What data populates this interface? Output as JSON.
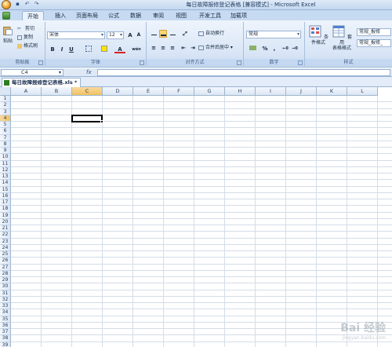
{
  "window": {
    "title": "每日故障报修登记表格 [兼容模式] - Microsoft Excel"
  },
  "quick_access": [
    "save-icon",
    "undo-icon",
    "redo-icon"
  ],
  "tabs": [
    "开始",
    "插入",
    "页面布局",
    "公式",
    "数据",
    "审阅",
    "视图",
    "开发工具",
    "加载项"
  ],
  "active_tab": "开始",
  "ribbon": {
    "clipboard": {
      "label": "剪贴板",
      "paste": "粘贴",
      "cut": "剪切",
      "copy": "复制",
      "format_painter": "格式刷"
    },
    "font": {
      "label": "字体",
      "name": "宋体",
      "size": "12",
      "bold": "B",
      "italic": "I",
      "underline": "U",
      "font_color_letter": "A",
      "grow": "A",
      "shrink": "A",
      "phonetic": "wén"
    },
    "alignment": {
      "label": "对齐方式",
      "wrap": "自动换行",
      "merge": "合并后居中"
    },
    "number": {
      "label": "数字",
      "format": "常规",
      "percent": "%",
      "comma": ","
    },
    "styles": {
      "label": "样式",
      "conditional": "条件格式",
      "table_format_1": "套用",
      "table_format_2": "表格格式",
      "cell_style_1": "常规_报修",
      "cell_style_2": "常规_报修_"
    }
  },
  "formula_bar": {
    "name_box": "C4",
    "fx": "fx",
    "value": ""
  },
  "workbook_tab": "每日故障报修登记表格.xls *",
  "columns": [
    "A",
    "B",
    "C",
    "D",
    "E",
    "F",
    "G",
    "H",
    "I",
    "J",
    "K",
    "L"
  ],
  "selected_column": "C",
  "selected_row": "4",
  "watermark": {
    "text": "Bai 经验",
    "sub": "jingyan.baidu.com"
  },
  "colors": {
    "ribbon": "#d9e6f6",
    "selection_header": "#f1c15f",
    "grid_line": "#d4dde9"
  }
}
